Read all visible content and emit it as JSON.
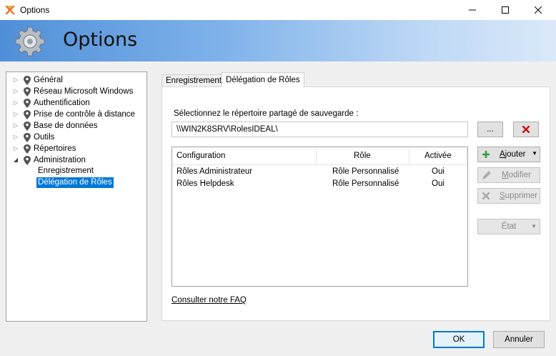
{
  "window": {
    "title": "Options"
  },
  "banner": {
    "title": "Options"
  },
  "tree": {
    "items": [
      {
        "label": "Général"
      },
      {
        "label": "Réseau Microsoft Windows"
      },
      {
        "label": "Authentification"
      },
      {
        "label": "Prise de contrôle à distance"
      },
      {
        "label": "Base de données"
      },
      {
        "label": "Outils"
      },
      {
        "label": "Répertoires"
      },
      {
        "label": "Administration"
      }
    ],
    "children": [
      {
        "label": "Enregistrement"
      },
      {
        "label": "Délégation de Rôles"
      }
    ]
  },
  "tabs": [
    {
      "label": "Enregistrement"
    },
    {
      "label": "Délégation de Rôles"
    }
  ],
  "directory": {
    "label": "Sélectionnez le répertoire partagé de sauvegarde :",
    "value": "\\\\WIN2K8SRV\\RolesIDEAL\\",
    "browse_label": "..."
  },
  "table": {
    "columns": [
      "Configuration",
      "Rôle",
      "Activée"
    ],
    "rows": [
      [
        "Rôles Administrateur",
        "Rôle Personnalisé",
        "Oui"
      ],
      [
        "Rôles Helpdesk",
        "Rôle Personnalisé",
        "Oui"
      ]
    ]
  },
  "actions": {
    "add_prefix": "A",
    "add_rest": "jouter",
    "modify_prefix": "M",
    "modify_rest": "odifier",
    "delete_prefix": "S",
    "delete_rest": "upprimer",
    "state_prefix": "É",
    "state_rest": "tat"
  },
  "faq": {
    "label": "Consulter notre FAQ"
  },
  "footer": {
    "ok": "OK",
    "cancel": "Annuler"
  },
  "colors": {
    "selection": "#0078d7",
    "delete_red": "#d01010",
    "add_green": "#3a9a3a"
  }
}
